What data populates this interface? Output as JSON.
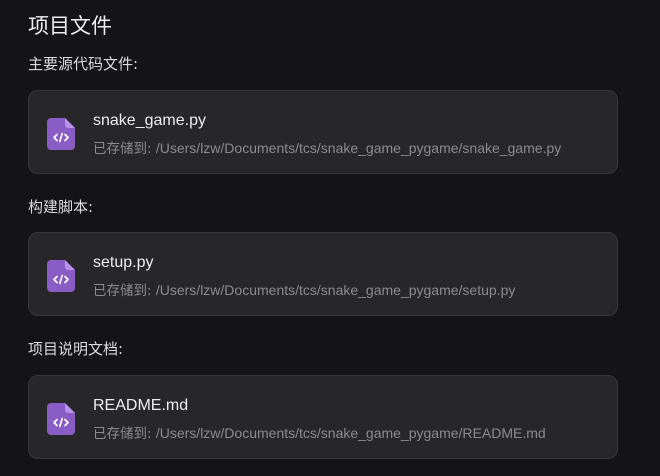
{
  "page": {
    "title": "项目文件"
  },
  "colors": {
    "background": "#141416",
    "card": "#272729",
    "icon_accent": "#8a5cc6",
    "text_primary": "#eeeef0",
    "text_secondary": "#8c8c90"
  },
  "sections": [
    {
      "label": "主要源代码文件:",
      "file": {
        "icon": "code-file-icon",
        "name": "snake_game.py",
        "saved_prefix": "已存储到:",
        "path": "/Users/lzw/Documents/tcs/snake_game_pygame/snake_game.py"
      }
    },
    {
      "label": "构建脚本:",
      "file": {
        "icon": "code-file-icon",
        "name": "setup.py",
        "saved_prefix": "已存储到:",
        "path": "/Users/lzw/Documents/tcs/snake_game_pygame/setup.py"
      }
    },
    {
      "label": "项目说明文档:",
      "file": {
        "icon": "code-file-icon",
        "name": "README.md",
        "saved_prefix": "已存储到:",
        "path": "/Users/lzw/Documents/tcs/snake_game_pygame/README.md"
      }
    }
  ]
}
